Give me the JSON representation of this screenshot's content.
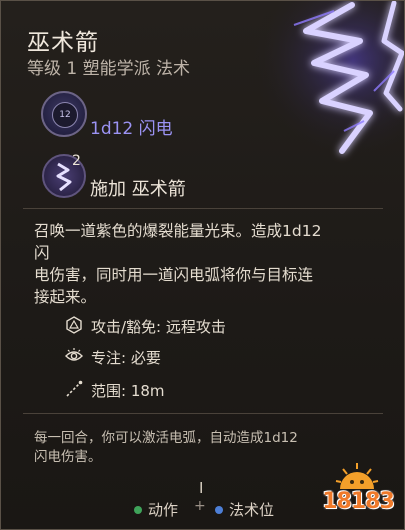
{
  "spell": {
    "name": "巫术箭",
    "subtitle": "等级 1 塑能学派 法术",
    "damage": "1d12 闪电",
    "damage_die": "12",
    "level_badge": "2",
    "action": "施加 巫术箭",
    "description_lines": [
      "召唤一道紫色的爆裂能量光束。造成1d12",
      "闪",
      "电伤害，同时用一道闪电弧将你与目标连",
      "接起来。"
    ],
    "stats": [
      {
        "icon": "d20-icon",
        "label": "攻击/豁免: 远程攻击"
      },
      {
        "icon": "concentration-eye-icon",
        "label": "专注: 必要"
      },
      {
        "icon": "range-icon",
        "label": "范围: 18m"
      }
    ],
    "extra_lines": [
      "每一回合，你可以激活电弧，自动造成1d12",
      "闪电伤害。"
    ]
  },
  "cursor": "I",
  "footer": {
    "action_label": "动作",
    "plus": "+",
    "slot_label": "法术位",
    "action_color": "#3fa35a",
    "slot_color": "#4d7fd6"
  },
  "watermark": "18183",
  "colors": {
    "damage_text": "#9b93f3",
    "bolt": "#8f7bff"
  }
}
